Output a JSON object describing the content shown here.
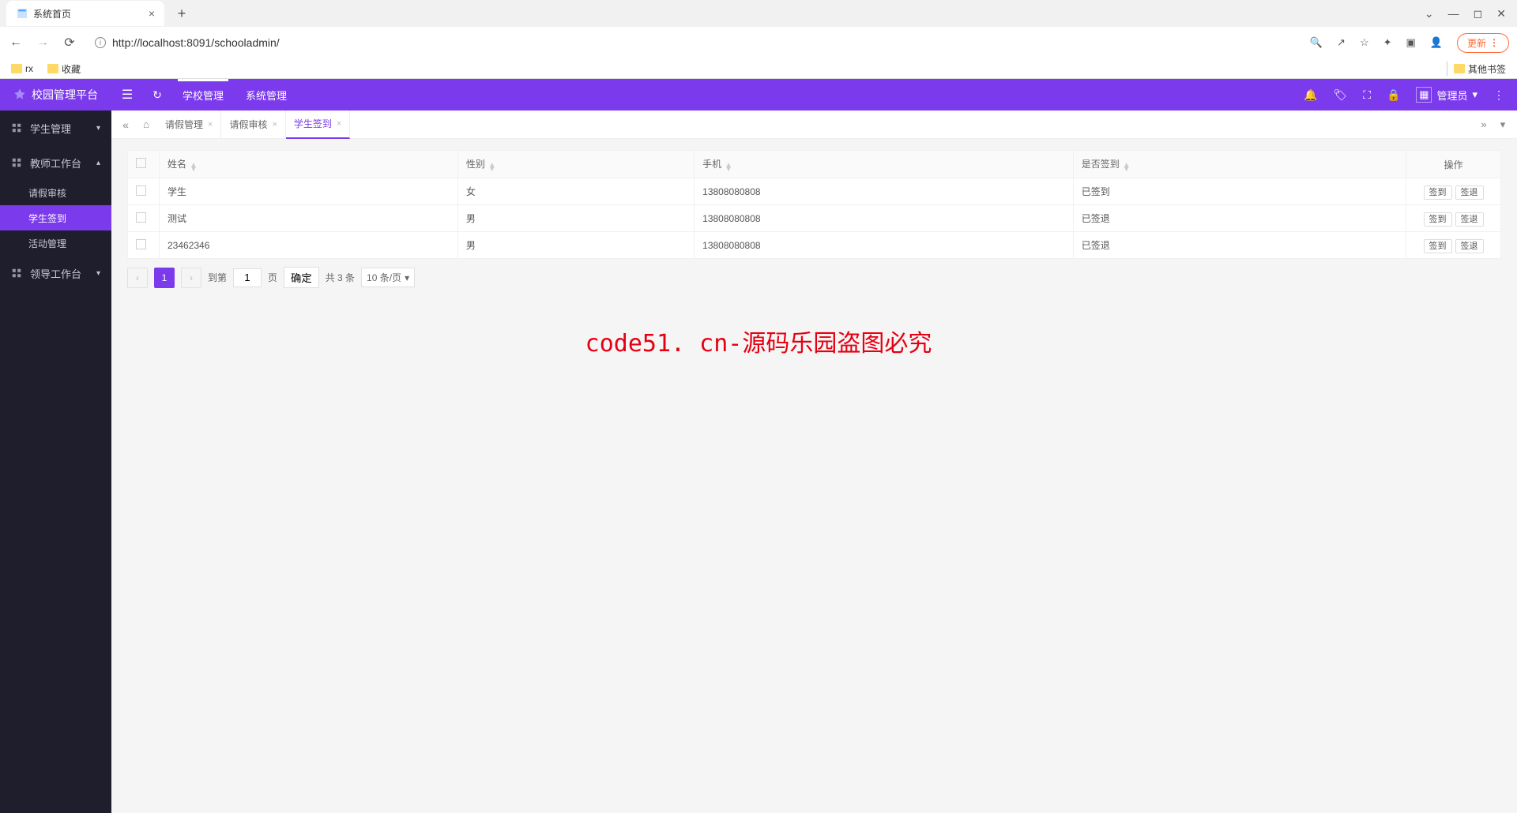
{
  "browser": {
    "tab_title": "系统首页",
    "url": "http://localhost:8091/schooladmin/",
    "update_label": "更新",
    "bookmarks": [
      "rx",
      "收藏"
    ],
    "other_bookmarks": "其他书签"
  },
  "header": {
    "brand": "校园管理平台",
    "menu": [
      "学校管理",
      "系统管理"
    ],
    "user_label": "管理员"
  },
  "sidebar": {
    "groups": [
      {
        "label": "学生管理",
        "expanded": false
      },
      {
        "label": "教师工作台",
        "expanded": true,
        "items": [
          "请假审核",
          "学生签到",
          "活动管理"
        ],
        "active_index": 1
      },
      {
        "label": "领导工作台",
        "expanded": false
      }
    ]
  },
  "page_tabs": {
    "items": [
      {
        "label": "请假管理",
        "closable": true
      },
      {
        "label": "请假审核",
        "closable": true
      },
      {
        "label": "学生签到",
        "closable": true,
        "active": true
      }
    ]
  },
  "table": {
    "columns": [
      "姓名",
      "性别",
      "手机",
      "是否签到",
      "操作"
    ],
    "rows": [
      {
        "name": "学生",
        "gender": "女",
        "phone": "13808080808",
        "status": "已签到"
      },
      {
        "name": "测试",
        "gender": "男",
        "phone": "13808080808",
        "status": "已签退"
      },
      {
        "name": "23462346",
        "gender": "男",
        "phone": "13808080808",
        "status": "已签退"
      }
    ],
    "row_actions": [
      "签到",
      "签退"
    ]
  },
  "pagination": {
    "current": "1",
    "goto_prefix": "到第",
    "goto_value": "1",
    "goto_suffix": "页",
    "confirm": "确定",
    "total_text": "共 3 条",
    "page_size": "10 条/页"
  },
  "watermark": "code51. cn-源码乐园盗图必究"
}
